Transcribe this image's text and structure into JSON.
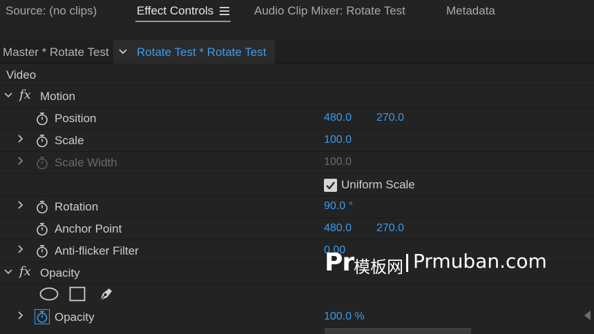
{
  "tabs": [
    {
      "label": "Source: (no clips)"
    },
    {
      "label": "Effect Controls"
    },
    {
      "label": "Audio Clip Mixer: Rotate Test"
    },
    {
      "label": "Metadata"
    }
  ],
  "sequence": {
    "master_label": "Master * Rotate Test",
    "clip_label": "Rotate Test * Rotate Test"
  },
  "section_video": "Video",
  "motion": {
    "label": "Motion",
    "position": {
      "label": "Position",
      "x": "480.0",
      "y": "270.0"
    },
    "scale": {
      "label": "Scale",
      "value": "100.0"
    },
    "scale_width": {
      "label": "Scale Width",
      "value": "100.0"
    },
    "uniform_scale": {
      "label": "Uniform Scale",
      "checked": true
    },
    "rotation": {
      "label": "Rotation",
      "value": "90.0 °"
    },
    "anchor_point": {
      "label": "Anchor Point",
      "x": "480.0",
      "y": "270.0"
    },
    "anti_flicker": {
      "label": "Anti-flicker Filter",
      "value": "0.00"
    }
  },
  "opacity_group": {
    "label": "Opacity",
    "opacity": {
      "label": "Opacity",
      "value": "100.0 %"
    }
  },
  "watermark": {
    "logo": "Pr",
    "chinese": "模板网",
    "url": "Prmuban.com"
  },
  "colors": {
    "accent": "#3d9bea",
    "background": "#232323",
    "text": "#cdcdcd"
  }
}
